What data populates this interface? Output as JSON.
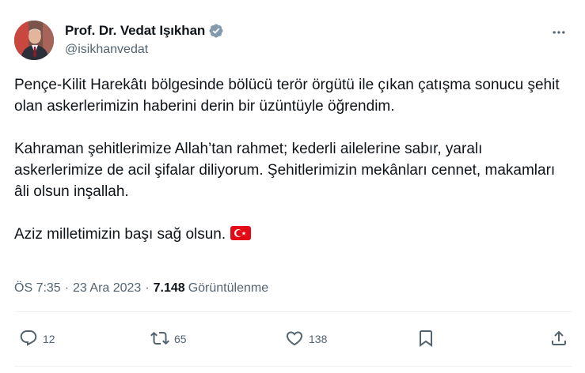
{
  "author": {
    "display_name": "Prof. Dr. Vedat Işıkhan",
    "handle": "@isikhanvedat",
    "verified": true
  },
  "tweet": {
    "paragraphs": [
      "Pençe-Kilit Harekâtı bölgesinde bölücü terör örgütü ile çıkan çatışma sonucu şehit olan askerlerimizin haberini derin bir üzüntüyle öğrendim.",
      "Kahraman şehitlerimize Allah’tan rahmet; kederli ailelerine sabır, yaralı askerlerimize de acil şifalar diliyorum. Şehitlerimizin mekânları cennet, makamları âli olsun inşallah.",
      "Aziz milletimizin başı sağ olsun."
    ],
    "emoji": "turkey-flag"
  },
  "meta": {
    "time": "ÖS 7:35",
    "separator": "·",
    "date": "23 Ara 2023",
    "views_count": "7.148",
    "views_label": "Görüntülenme"
  },
  "actions": {
    "replies": "12",
    "retweets": "65",
    "likes": "138"
  },
  "icons": {
    "more": "more-horizontal-icon",
    "reply": "reply-icon",
    "retweet": "retweet-icon",
    "like": "heart-icon",
    "bookmark": "bookmark-icon",
    "share": "share-icon",
    "verified": "verified-badge-icon"
  },
  "colors": {
    "text": "#0f1419",
    "secondary": "#536471",
    "verified_badge": "#829aab",
    "flag_red": "#e30a17",
    "divider": "#eff3f4"
  }
}
